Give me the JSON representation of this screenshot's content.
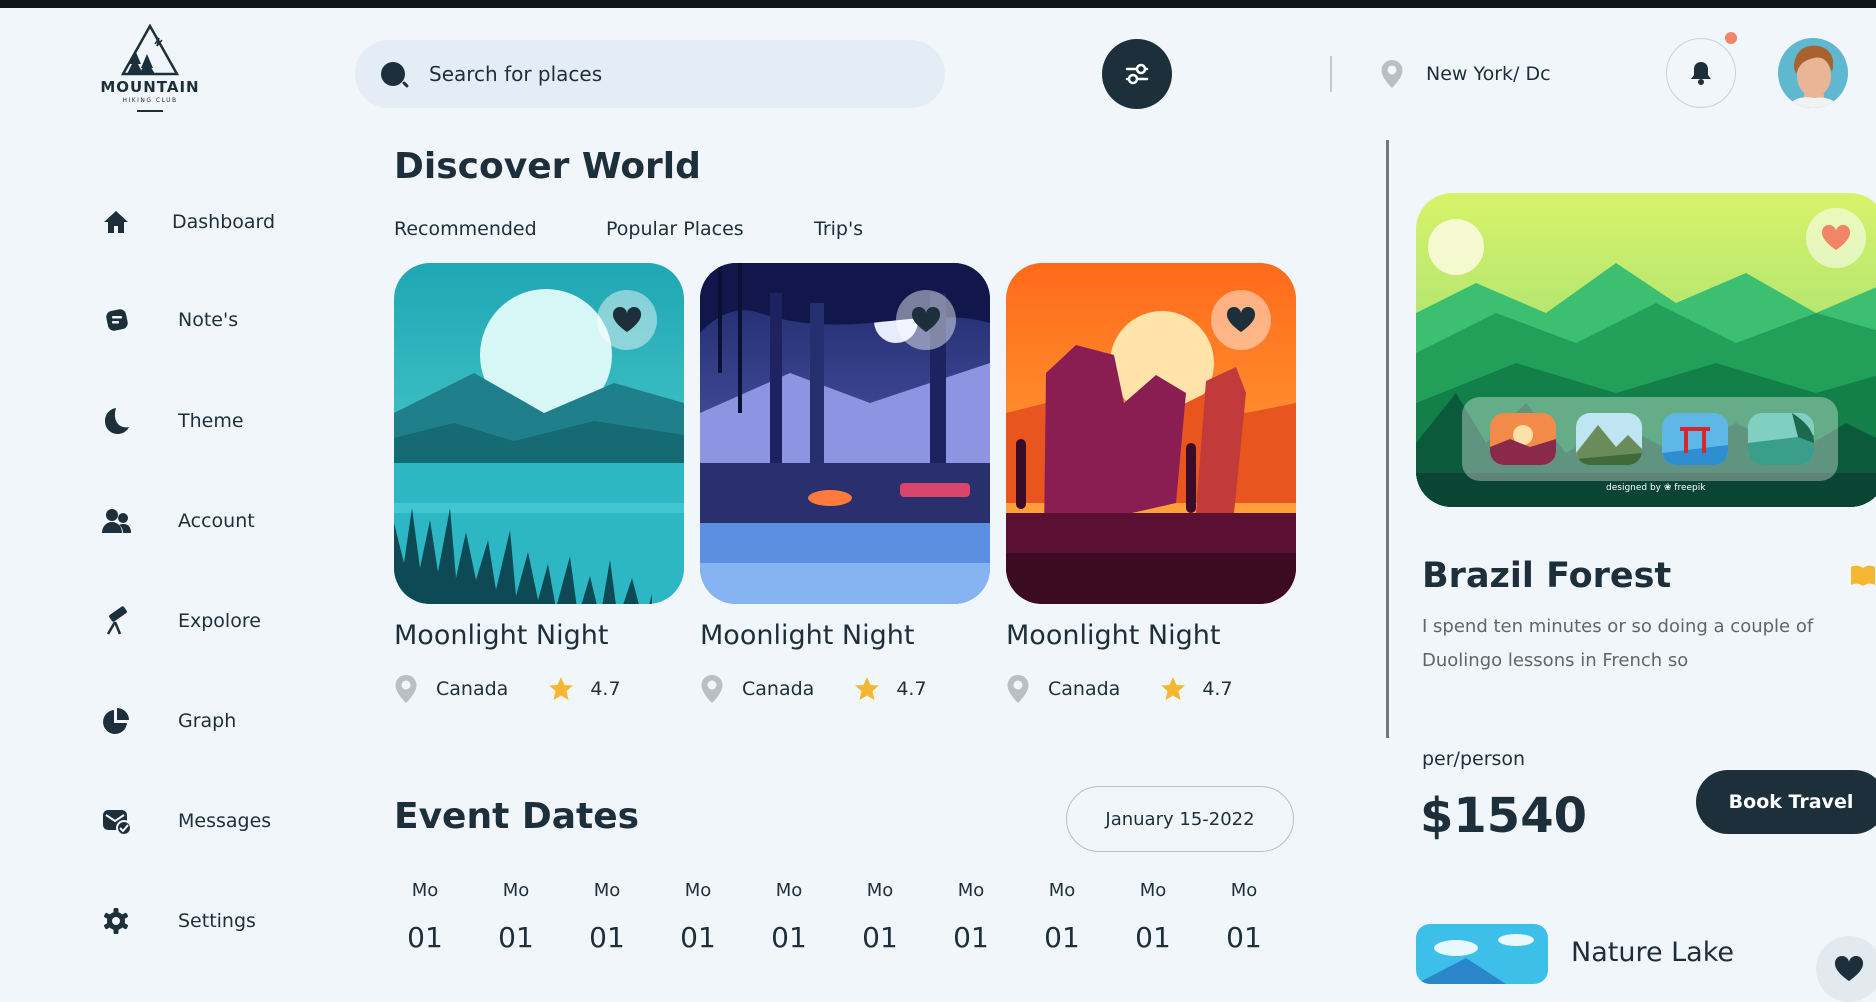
{
  "brand": {
    "title": "MOUNTAIN",
    "subtitle": "HIKING CLUB"
  },
  "search": {
    "placeholder": "Search for places"
  },
  "header": {
    "location": "New York/ Dc"
  },
  "sidebar": {
    "items": [
      {
        "label": "Dashboard",
        "icon": "home-icon"
      },
      {
        "label": "Note's",
        "icon": "notes-icon"
      },
      {
        "label": "Theme",
        "icon": "moon-icon"
      },
      {
        "label": "Account",
        "icon": "users-icon"
      },
      {
        "label": "Expolore",
        "icon": "telescope-icon"
      },
      {
        "label": "Graph",
        "icon": "pie-chart-icon"
      },
      {
        "label": "Messages",
        "icon": "message-check-icon"
      },
      {
        "label": "Settings",
        "icon": "gear-icon"
      }
    ]
  },
  "discover": {
    "heading": "Discover World",
    "tabs": [
      "Recommended",
      "Popular Places",
      "Trip's"
    ],
    "cards": [
      {
        "title": "Moonlight Night",
        "location": "Canada",
        "rating": "4.7"
      },
      {
        "title": "Moonlight Night",
        "location": "Canada",
        "rating": "4.7"
      },
      {
        "title": "Moonlight Night",
        "location": "Canada",
        "rating": "4.7"
      }
    ]
  },
  "events": {
    "heading": "Event Dates",
    "date_range": "January 15-2022",
    "days": [
      {
        "name": "Mo",
        "num": "01"
      },
      {
        "name": "Mo",
        "num": "01"
      },
      {
        "name": "Mo",
        "num": "01"
      },
      {
        "name": "Mo",
        "num": "01"
      },
      {
        "name": "Mo",
        "num": "01"
      },
      {
        "name": "Mo",
        "num": "01"
      },
      {
        "name": "Mo",
        "num": "01"
      },
      {
        "name": "Mo",
        "num": "01"
      },
      {
        "name": "Mo",
        "num": "01"
      },
      {
        "name": "Mo",
        "num": "01"
      }
    ]
  },
  "feature": {
    "credit": "designed by ❀ freepik",
    "title": "Brazil Forest",
    "description": "I spend ten minutes or so doing a couple of Duolingo lessons in French so",
    "price_label": "per/person",
    "price": "$1540",
    "cta": "Book Travel"
  },
  "next_place": {
    "title": "Nature Lake"
  },
  "colors": {
    "primary": "#1d2f3a",
    "background": "#f1f6fb",
    "accent": "#f28467",
    "star": "#f5b731"
  }
}
